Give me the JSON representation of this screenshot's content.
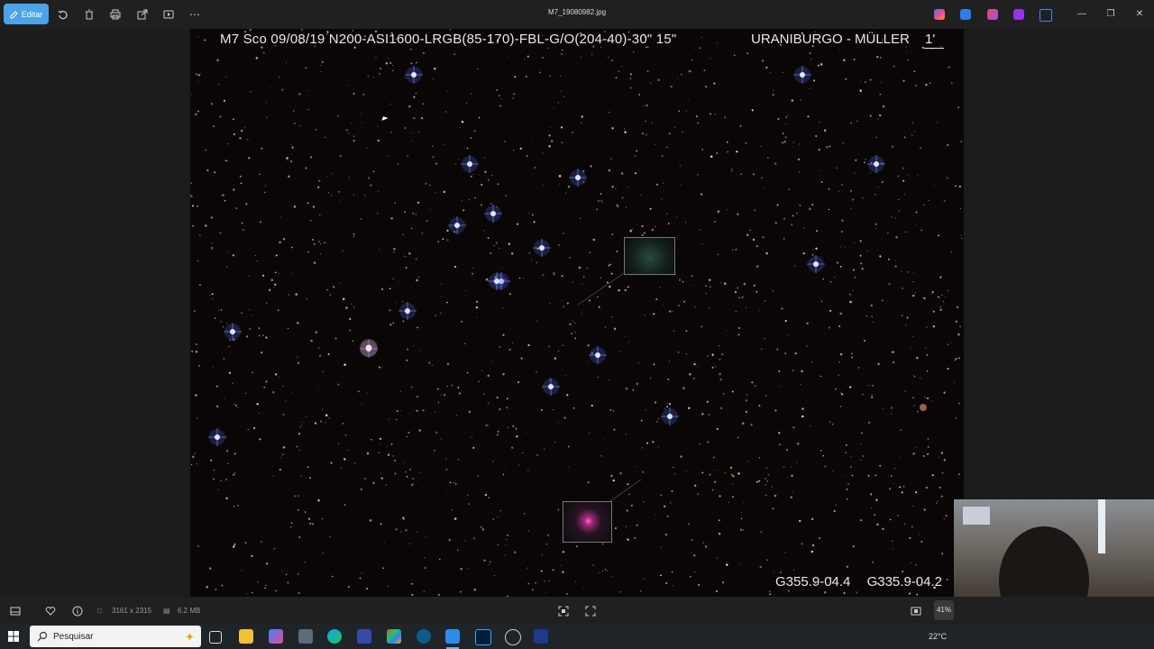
{
  "titlebar": {
    "edit_label": "Editar",
    "filename": "M7_19080982.jpg"
  },
  "image": {
    "caption_left": "M7  Sco  09/08/19  N200-ASI1600-LRGB(85-170)-FBL-G/O(204-40)-30\"  15\"",
    "caption_right": "URANIBURGO - MÜLLER",
    "scale_label": "1'",
    "id_1": "G355.9-04.4",
    "id_2": "G335.9-04.2"
  },
  "bottombar": {
    "dimensions": "3161 x 2315",
    "filesize": "6.2 MB",
    "zoom": "41%"
  },
  "taskbar": {
    "search_placeholder": "Pesquisar",
    "temperature": "22°C"
  },
  "colors": {
    "accent": "#4da3e8",
    "background": "#1c1c1c",
    "taskbar": "#1f2428"
  }
}
